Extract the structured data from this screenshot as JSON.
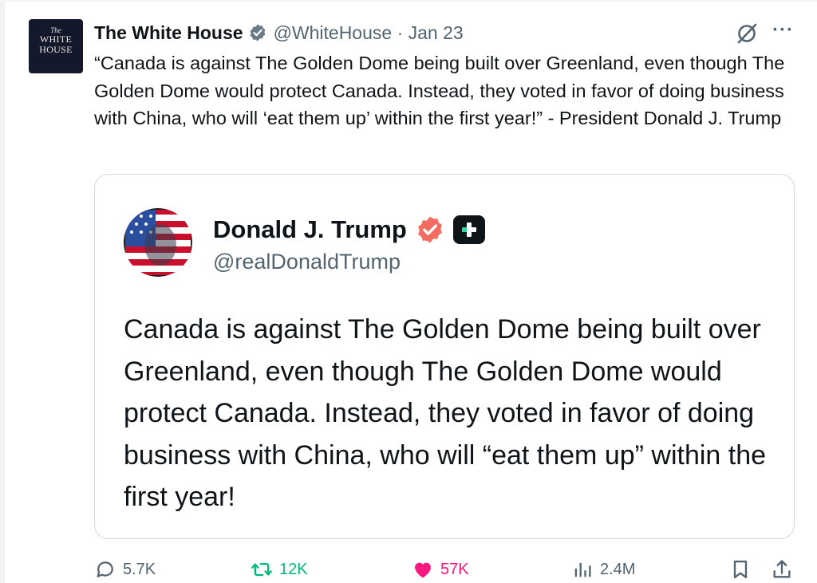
{
  "post": {
    "author_avatar": {
      "line1": "The",
      "line2": "WHITE",
      "line3": "HOUSE"
    },
    "author_name": "The White House",
    "author_handle": "@WhiteHouse · Jan 23",
    "text": "“Canada is against The Golden Dome being built over Greenland, even though The Golden Dome would protect Canada. Instead, they voted in favor of doing business with China, who will ‘eat them up’ within the first year!” - President Donald J. Trump"
  },
  "quote": {
    "name": "Donald J. Trump",
    "handle": "@realDonaldTrump",
    "text": "Canada is against The Golden Dome being built over Greenland, even though The Golden Dome would protect Canada. Instead, they voted in favor of doing business with China, who will “eat them up” within the first year!"
  },
  "actions": {
    "replies": "5.7K",
    "reposts": "12K",
    "likes": "57K",
    "views": "2.4M"
  },
  "colors": {
    "verified_blue": "#1d9bf0",
    "repost_green": "#00ba7c",
    "like_pink": "#f91880",
    "secondary_text": "#536471",
    "badge_orange": "#f26c62"
  },
  "icons": [
    "verified-icon",
    "grok-icon",
    "more-icon",
    "plus-icon",
    "reply-icon",
    "repost-icon",
    "like-icon",
    "views-icon",
    "bookmark-icon",
    "share-icon"
  ]
}
